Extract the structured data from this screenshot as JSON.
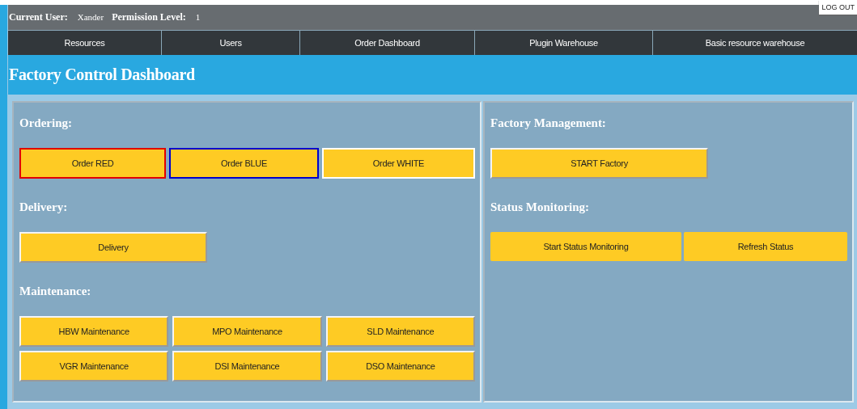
{
  "header": {
    "user_label": "Current User:",
    "user_name": "Xander",
    "permission_label": "Permission Level:",
    "permission_value": "1",
    "logout": "LOG OUT"
  },
  "nav": [
    {
      "label": "Resources"
    },
    {
      "label": "Users"
    },
    {
      "label": "Order Dashboard"
    },
    {
      "label": "Plugin Warehouse"
    },
    {
      "label": "Basic resource warehouse"
    }
  ],
  "title": "Factory Control Dashboard",
  "left_panel": {
    "sections": [
      {
        "heading": "Ordering:",
        "kind": "order",
        "buttons": [
          {
            "label": "Order RED",
            "color": "#e00000"
          },
          {
            "label": "Order BLUE",
            "color": "#0000cc"
          },
          {
            "label": "Order WHITE",
            "color": "#ffffff"
          }
        ]
      },
      {
        "heading": "Delivery:",
        "kind": "single",
        "buttons": [
          {
            "label": "Delivery"
          }
        ]
      },
      {
        "heading": "Maintenance:",
        "kind": "grid",
        "buttons": [
          {
            "label": "HBW Maintenance"
          },
          {
            "label": "MPO Maintenance"
          },
          {
            "label": "SLD Maintenance"
          },
          {
            "label": "VGR Maintenance"
          },
          {
            "label": "DSI Maintenance"
          },
          {
            "label": "DSO Maintenance"
          }
        ]
      }
    ]
  },
  "right_panel": {
    "sections": [
      {
        "heading": "Factory Management:",
        "kind": "single",
        "buttons": [
          {
            "label": "START Factory"
          }
        ]
      },
      {
        "heading": "Status Monitoring:",
        "kind": "pair",
        "buttons": [
          {
            "label": "Start Status Monitoring"
          },
          {
            "label": "Refresh Status"
          }
        ]
      }
    ]
  }
}
